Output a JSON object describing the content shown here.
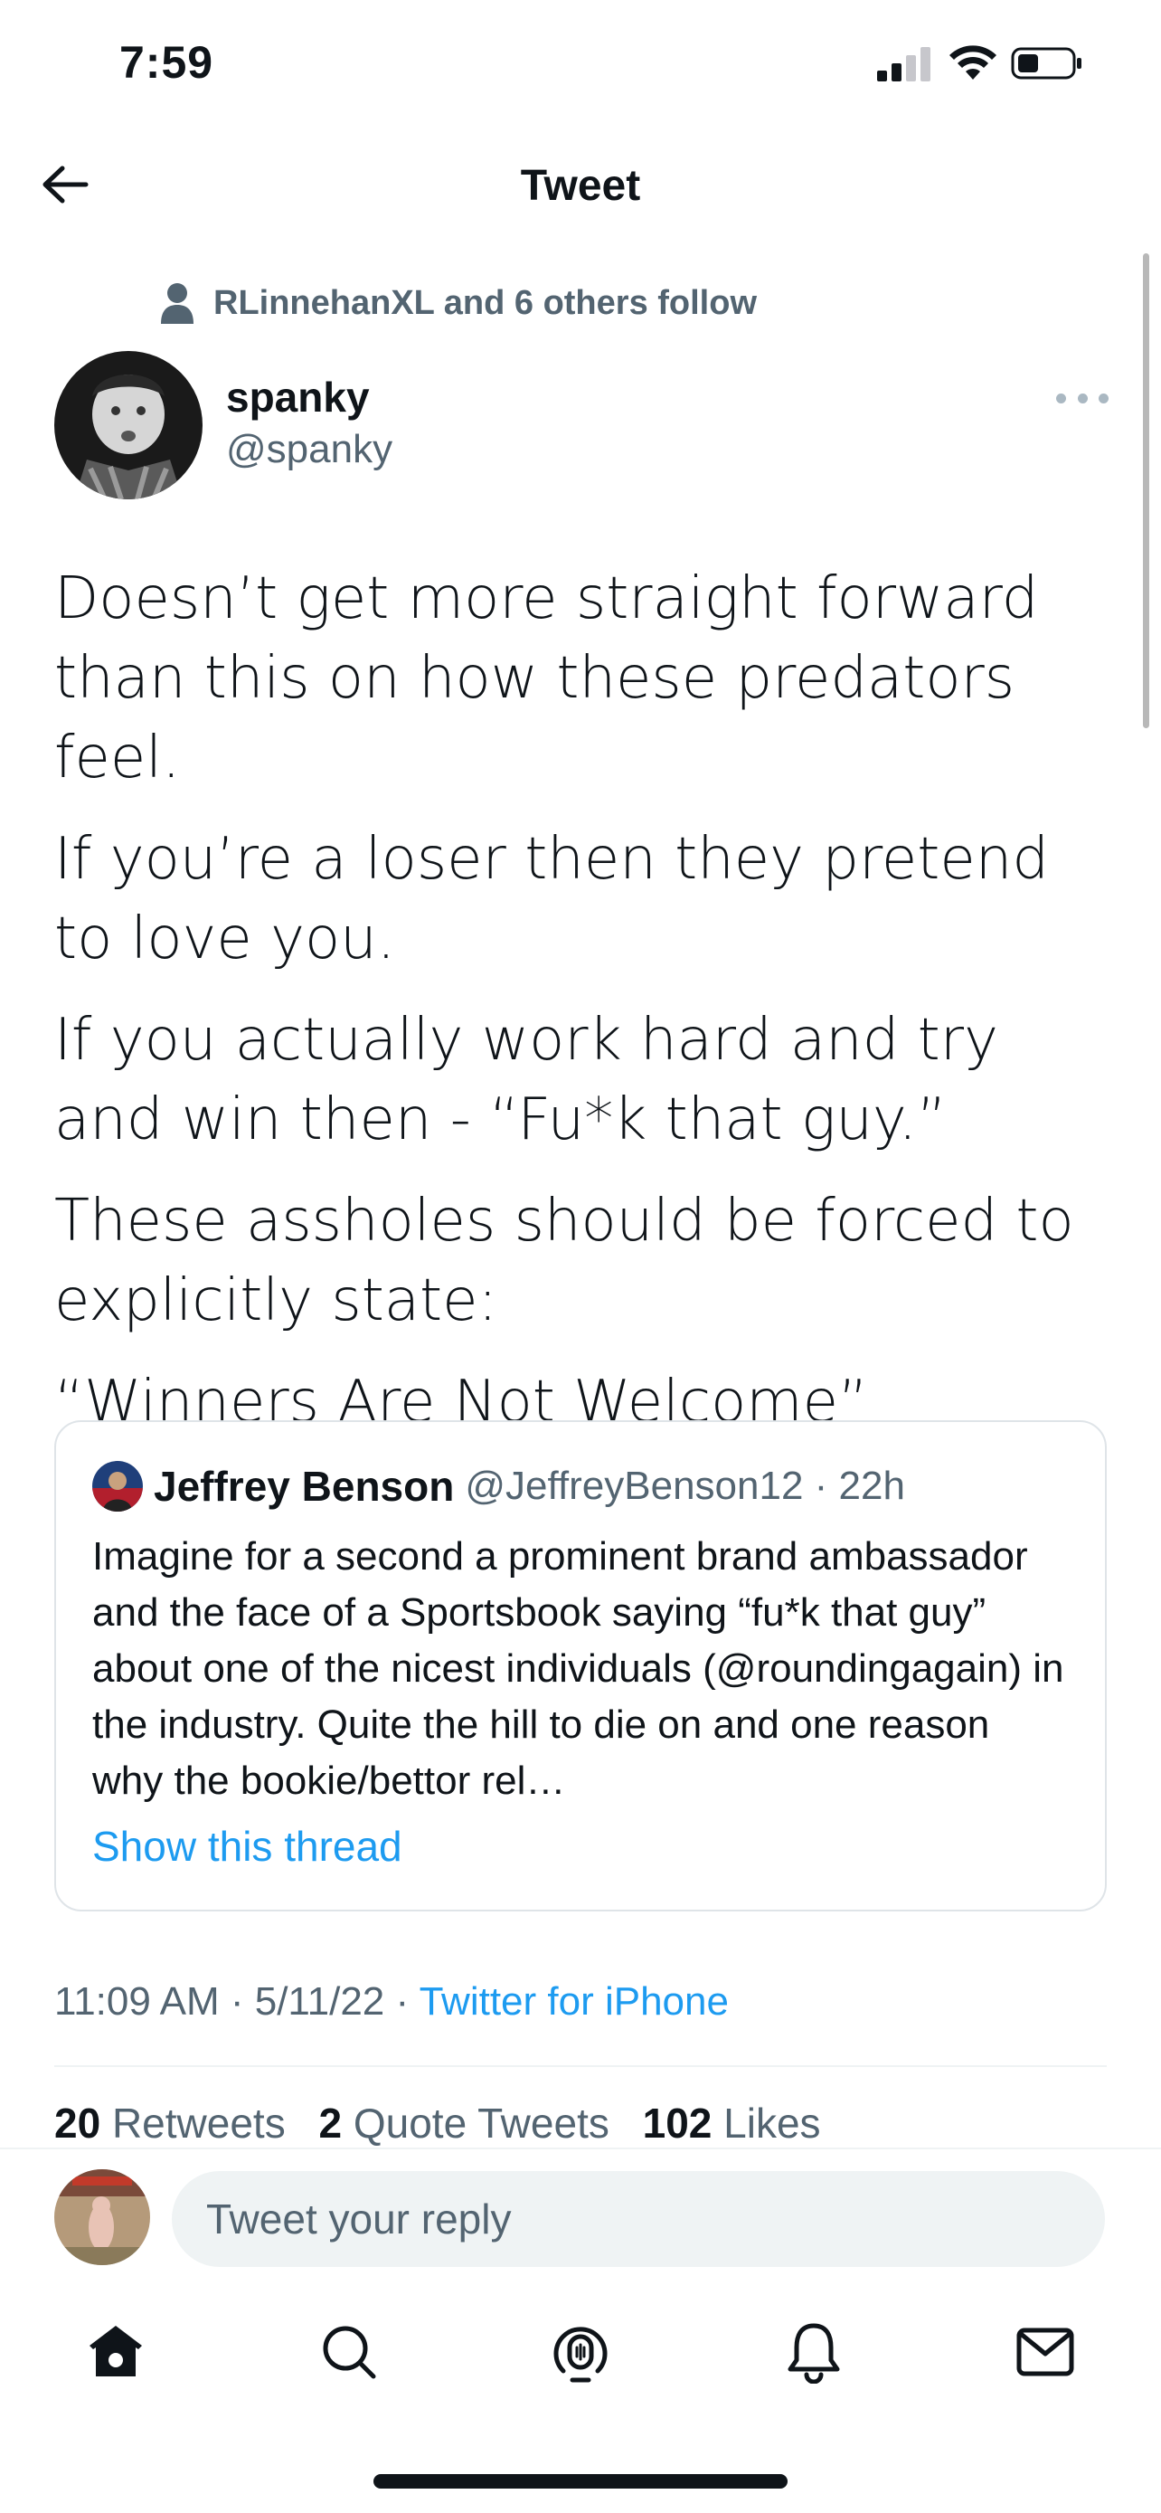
{
  "status_bar": {
    "time": "7:59"
  },
  "header": {
    "title": "Tweet"
  },
  "tweet": {
    "social_context": "RLinnehanXL and 6 others follow",
    "author": {
      "name": "spanky",
      "handle": "@spanky"
    },
    "paragraphs": [
      "Doesn’t get more straight forward than this on how these predators feel.",
      "If you’re a loser then they pretend to love you.",
      "If you actually work hard and try and win then - “Fu*k that guy.”",
      "These assholes should be forced to explicitly state:",
      "“Winners Are Not Welcome”"
    ],
    "quote": {
      "name": "Jeffrey Benson",
      "handle_time": "@JeffreyBenson12 · 22h",
      "text": "Imagine for a second a prominent brand ambassador and the face of a Sportsbook saying “fu*k that guy” about one of the nicest individuals (@roundingagain) in the industry. Quite the hill to die on and one reason why the bookie/bettor rel…",
      "show_thread": "Show this thread"
    },
    "meta": {
      "time_date": "11:09 AM · 5/11/22 · ",
      "source": "Twitter for iPhone"
    },
    "stats": {
      "retweets_count": "20",
      "retweets_label": "Retweets",
      "quotes_count": "2",
      "quotes_label": "Quote Tweets",
      "likes_count": "102",
      "likes_label": "Likes"
    }
  },
  "reply": {
    "placeholder": "Tweet your reply"
  },
  "tabs": [
    "home-icon",
    "search-icon",
    "spaces-icon",
    "notifications-icon",
    "messages-icon"
  ],
  "colors": {
    "accent": "#1d9bf0",
    "secondary_text": "#536471",
    "primary_text": "#0f1419",
    "border": "#dfe4e8"
  }
}
